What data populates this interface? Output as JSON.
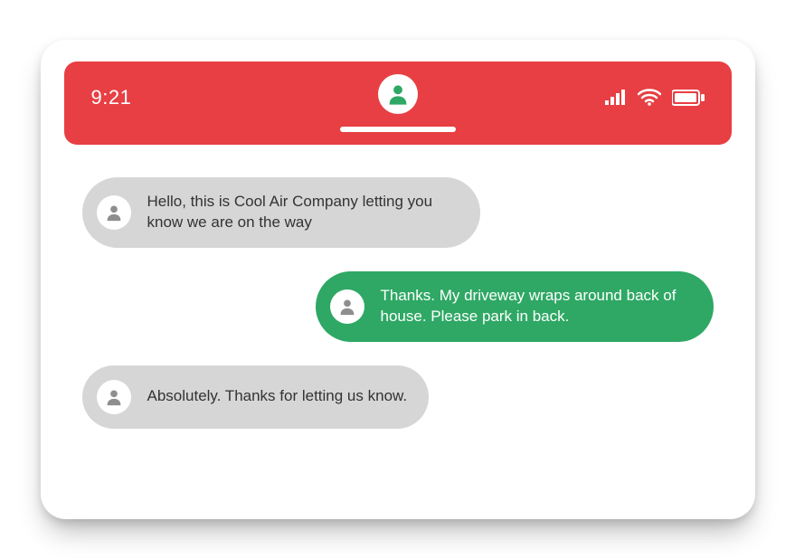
{
  "colors": {
    "header_bg": "#e73f43",
    "outgoing_bg": "#2ea864",
    "incoming_bg": "#d6d6d6",
    "header_avatar_icon": "#2ea864",
    "bubble_avatar_icon": "#8e8e8e"
  },
  "status_bar": {
    "time": "9:21"
  },
  "messages": [
    {
      "direction": "incoming",
      "text": "Hello, this is Cool Air Company letting you know we are on the way"
    },
    {
      "direction": "outgoing",
      "text": "Thanks. My driveway wraps around back of house. Please park in back."
    },
    {
      "direction": "incoming",
      "text": "Absolutely. Thanks for letting us know."
    }
  ]
}
